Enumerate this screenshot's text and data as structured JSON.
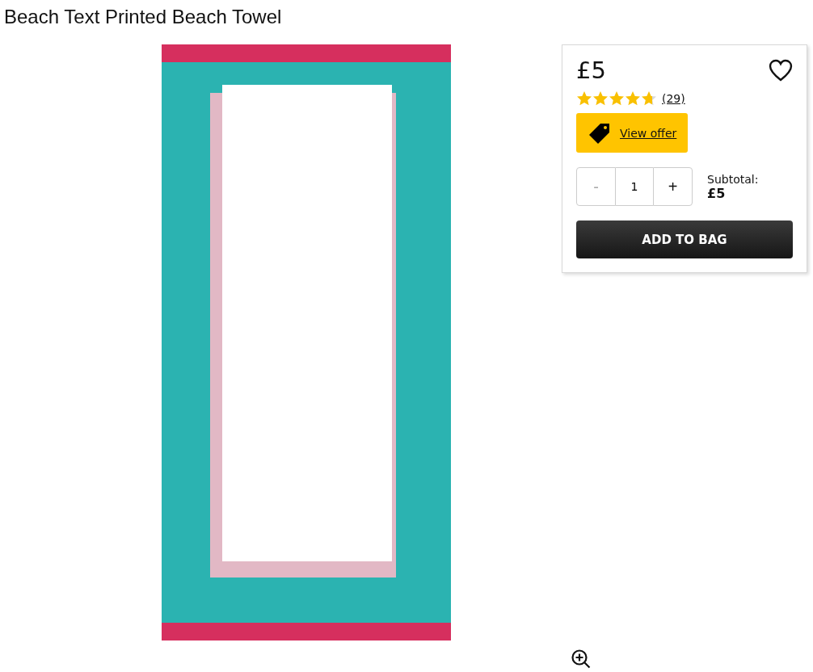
{
  "product": {
    "title": "Beach Text Printed Beach Towel"
  },
  "buy_box": {
    "price": "£5",
    "favourite": {
      "selected": false
    },
    "rating": {
      "stars": 4.7,
      "count": "(29)"
    },
    "offer_button": "View offer",
    "quantity": {
      "decrease": "-",
      "decrease_disabled": true,
      "value": "1",
      "increase": "+"
    },
    "subtotal_label": "Subtotal:",
    "subtotal": "£5",
    "add_button": "ADD TO BAG"
  }
}
